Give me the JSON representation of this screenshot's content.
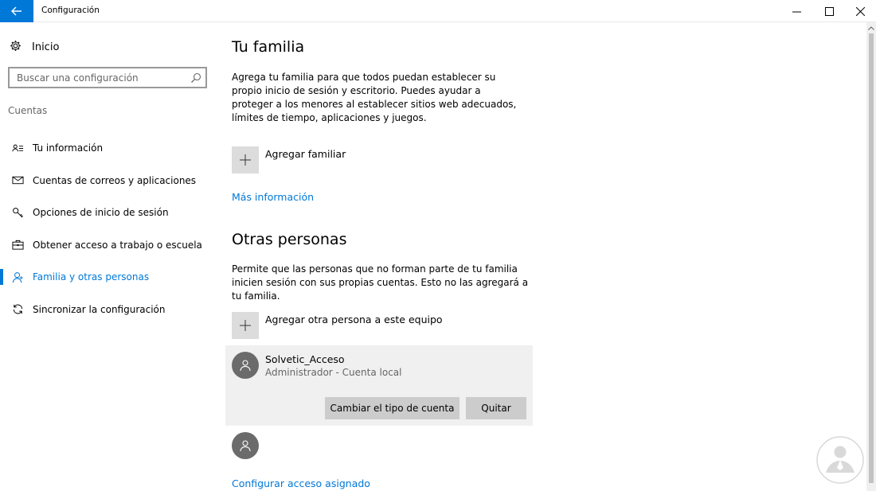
{
  "window": {
    "title": "Configuración",
    "back_icon": "back-arrow-icon",
    "controls": [
      "minimize-icon",
      "maximize-icon",
      "close-icon"
    ]
  },
  "sidebar": {
    "home_label": "Inicio",
    "search_placeholder": "Buscar una configuración",
    "section": "Cuentas",
    "items": [
      {
        "label": "Tu información",
        "icon": "person-card-icon",
        "active": false
      },
      {
        "label": "Cuentas de correos y aplicaciones",
        "icon": "mail-icon",
        "active": false
      },
      {
        "label": "Opciones de inicio de sesión",
        "icon": "key-icon",
        "active": false
      },
      {
        "label": "Obtener acceso a trabajo o escuela",
        "icon": "briefcase-icon",
        "active": false
      },
      {
        "label": "Familia y otras personas",
        "icon": "person-icon",
        "active": true
      },
      {
        "label": "Sincronizar la configuración",
        "icon": "sync-icon",
        "active": false
      }
    ]
  },
  "main": {
    "family": {
      "heading": "Tu familia",
      "description": "Agrega tu familia para que todos puedan establecer su propio inicio de sesión y escritorio. Puedes ayudar a proteger a los menores al establecer sitios web adecuados, límites de tiempo, aplicaciones y juegos.",
      "add_label": "Agregar familiar",
      "more_info": "Más información"
    },
    "others": {
      "heading": "Otras personas",
      "description": "Permite que las personas que no forman parte de tu familia inicien sesión con sus propias cuentas. Esto no las agregará a tu familia.",
      "add_label": "Agregar otra persona a este equipo",
      "account": {
        "name": "Solvetic_Acceso",
        "role": "Administrador - Cuenta local",
        "change_type_button": "Cambiar el tipo de cuenta",
        "remove_button": "Quitar"
      },
      "assigned_access_link": "Configurar acceso asignado"
    }
  },
  "colors": {
    "accent": "#0078d7",
    "tile": "#dcdcdc",
    "card": "#f0f0f0",
    "button": "#cccccc"
  }
}
